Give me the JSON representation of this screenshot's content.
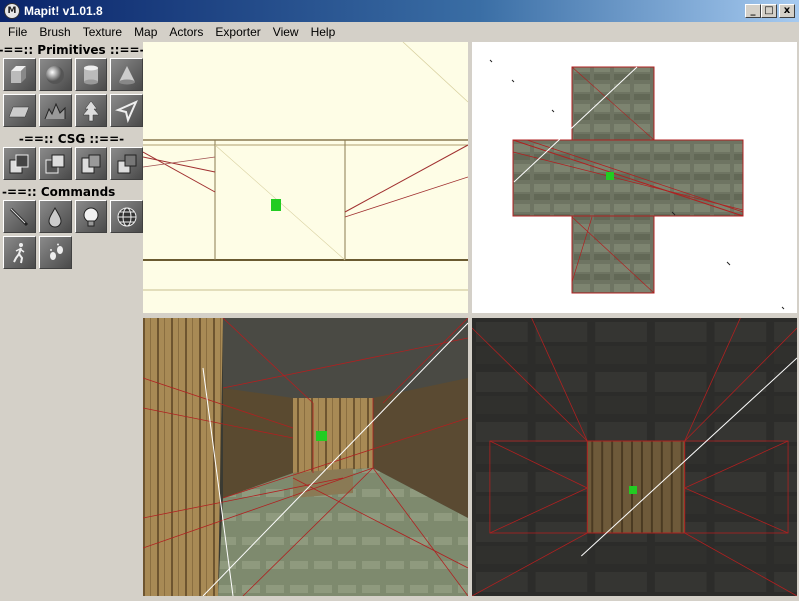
{
  "window": {
    "title": "Mapit! v1.01.8",
    "icon_text": "M"
  },
  "controls": {
    "minimize": "_",
    "maximize": "□",
    "close": "x"
  },
  "menu": [
    "File",
    "Brush",
    "Texture",
    "Map",
    "Actors",
    "Exporter",
    "View",
    "Help"
  ],
  "toolbox": {
    "primitives_header": "-==:: Primitives ::==-",
    "csg_header": "-==::     CSG     ::==-",
    "commands_header": "-==:: Commands",
    "primitives": [
      "cube-icon",
      "sphere-icon",
      "cylinder-icon",
      "cone-icon",
      "plane-icon",
      "terrain-icon",
      "tree-icon",
      "arrow-icon"
    ],
    "csg": [
      "csg-subtract-icon",
      "csg-intersect-icon",
      "csg-union-icon",
      "csg-split-icon"
    ],
    "commands": [
      "pen-icon",
      "drop-icon",
      "light-bulb-icon",
      "globe-icon",
      "walk-icon",
      "footprints-icon"
    ]
  },
  "viewports": {
    "top_left": {
      "view": "side-orthographic",
      "background": "#fefde6"
    },
    "top_right": {
      "view": "top-orthographic",
      "background": "#ffffff"
    },
    "bottom_left": {
      "view": "perspective-3d"
    },
    "bottom_right": {
      "view": "front-orthographic"
    }
  },
  "colors": {
    "brush_edge": "#b02020",
    "actor": "#22cc22",
    "guide_line": "#ffffff"
  }
}
